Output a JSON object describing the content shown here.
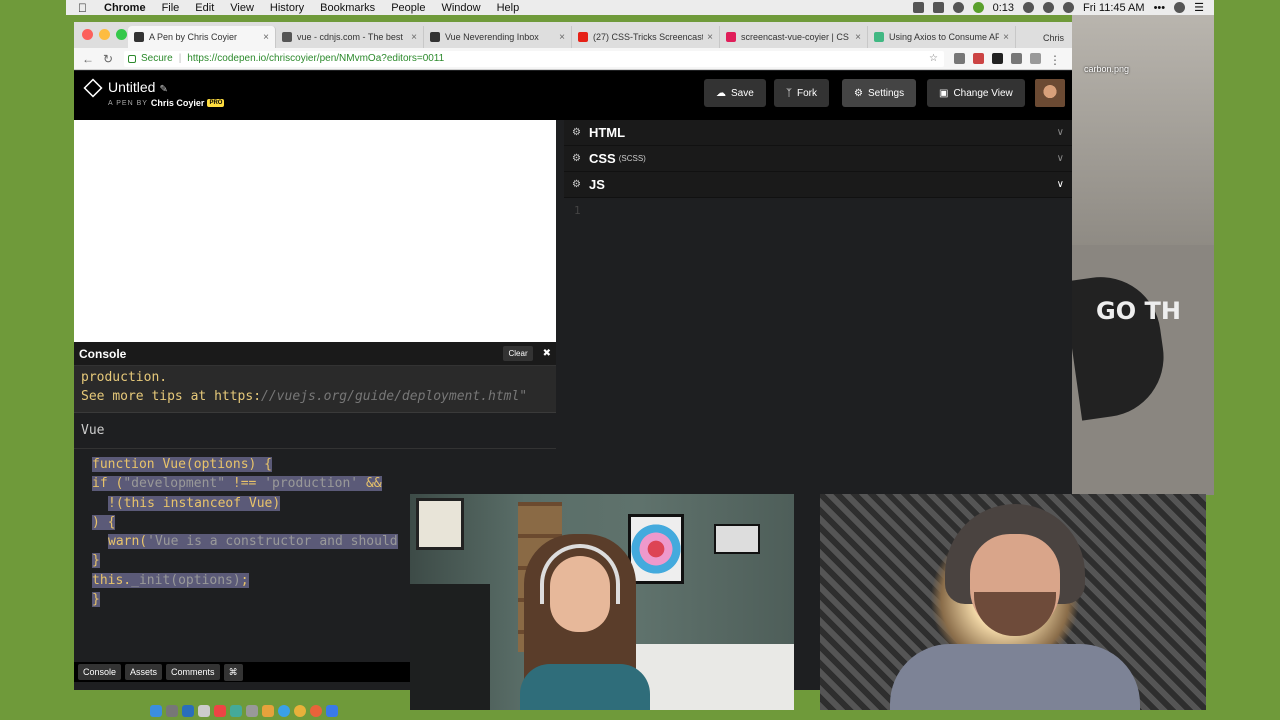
{
  "menubar": {
    "app": "Chrome",
    "items": [
      "File",
      "Edit",
      "View",
      "History",
      "Bookmarks",
      "People",
      "Window",
      "Help"
    ],
    "battery_time": "0:13",
    "clock": "Fri 11:45 AM"
  },
  "desktop": {
    "file_label": "carbon.png",
    "poster_text": "GO TH"
  },
  "tabs": [
    {
      "title": "A Pen by Chris Coyier",
      "active": true,
      "color": "#333333"
    },
    {
      "title": "vue - cdnjs.com - The best",
      "color": "#555555"
    },
    {
      "title": "Vue Neverending Inbox",
      "color": "#333333"
    },
    {
      "title": "(27) CSS-Tricks Screencast",
      "color": "#e62117"
    },
    {
      "title": "screencast-vue-coyier | CS",
      "color": "#e01e5a"
    },
    {
      "title": "Using Axios to Consume AP",
      "color": "#41b883"
    }
  ],
  "profile_name": "Chris",
  "address": {
    "secure_label": "Secure",
    "url": "https://codepen.io/chriscoyier/pen/NMvmOa?editors=0011"
  },
  "codepen": {
    "title": "Untitled",
    "byline_prefix": "A PEN BY",
    "author": "Chris Coyier",
    "pro_badge": "PRO",
    "buttons": {
      "save": "Save",
      "fork": "Fork",
      "settings": "Settings",
      "change_view": "Change View"
    }
  },
  "console": {
    "title": "Console",
    "clear": "Clear",
    "log_line1": "production.",
    "log_line2_prefix": "See ",
    "log_line2_mid": "more tips at ",
    "log_line2_url_label": "https:",
    "log_line2_url": "//vuejs.org/guide/deployment.html\"",
    "vue_output": "Vue",
    "code": {
      "l1": "function Vue(options) {",
      "l2a": "if (",
      "l2b": "\"development\"",
      "l2c": " !== ",
      "l2d": "'production'",
      "l2e": " &&",
      "l3": "!(this instanceof Vue)",
      "l4": ") {",
      "l5a": "warn(",
      "l5b": "'Vue is a constructor and should",
      "l6": "}",
      "l7a": "this.",
      "l7b": "_init(options)",
      "l7c": ";",
      "l8": "}"
    },
    "prompt": ">"
  },
  "footer": {
    "console": "Console",
    "assets": "Assets",
    "comments": "Comments",
    "shortcut": "⌘"
  },
  "editors": {
    "html": "HTML",
    "css": "CSS",
    "css_sub": "(SCSS)",
    "js": "JS",
    "js_line_number": "1"
  }
}
